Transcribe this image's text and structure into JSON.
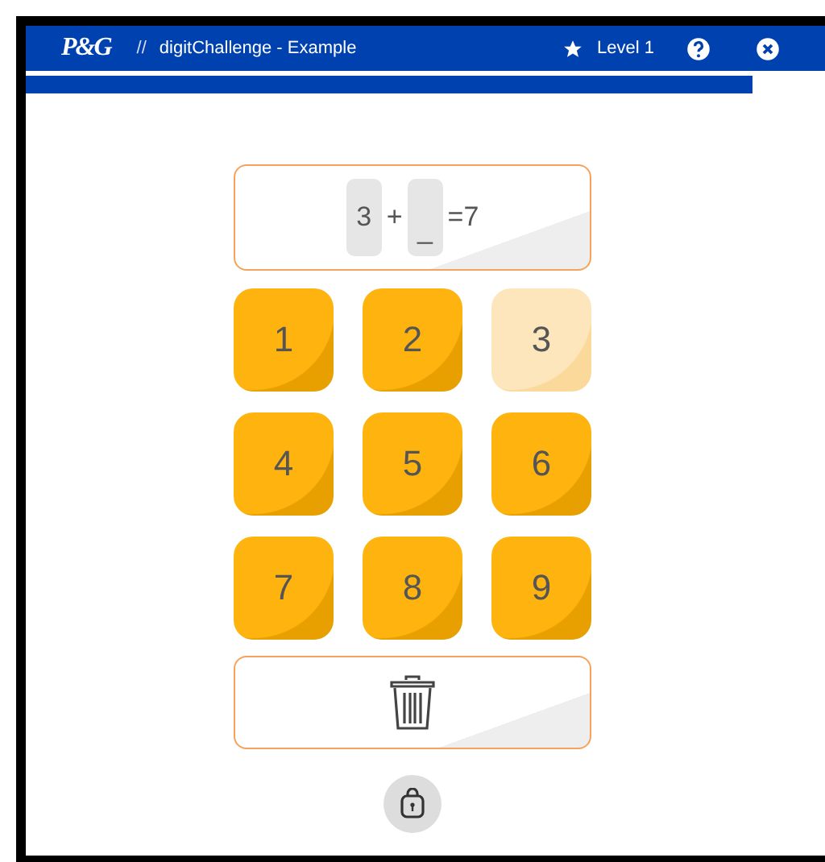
{
  "header": {
    "logo": "P&G",
    "separator": "//",
    "title": "digitChallenge - Example",
    "level": "Level 1"
  },
  "progress": {
    "level": 0.91
  },
  "equation": [
    {
      "kind": "slot",
      "text": "3"
    },
    {
      "kind": "text",
      "text": "+"
    },
    {
      "kind": "slot",
      "text": "_"
    },
    {
      "kind": "text",
      "text": "=7"
    }
  ],
  "keys": [
    {
      "label": "1",
      "disabled": false
    },
    {
      "label": "2",
      "disabled": false
    },
    {
      "label": "3",
      "disabled": true
    },
    {
      "label": "4",
      "disabled": false
    },
    {
      "label": "5",
      "disabled": false
    },
    {
      "label": "6",
      "disabled": false
    },
    {
      "label": "7",
      "disabled": false
    },
    {
      "label": "8",
      "disabled": false
    },
    {
      "label": "9",
      "disabled": false
    }
  ]
}
